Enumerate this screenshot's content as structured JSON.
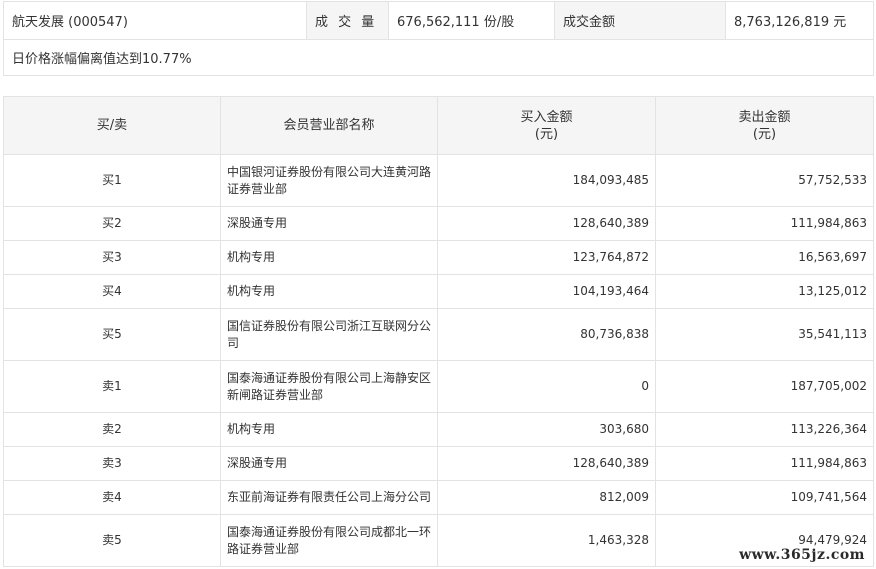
{
  "summary": {
    "stock": "航天发展 (000547)",
    "volume_label": "成 交 量",
    "volume_value": "676,562,111 份/股",
    "amount_label": "成交金额",
    "amount_value": "8,763,126,819 元",
    "note": "日价格涨幅偏离值达到10.77%"
  },
  "table": {
    "headers": {
      "side": "买/卖",
      "name": "会员营业部名称",
      "buy": "买入金额",
      "buy_unit": "(元)",
      "sell": "卖出金额",
      "sell_unit": "(元)"
    },
    "rows": [
      {
        "side": "买1",
        "name": "中国银河证券股份有限公司大连黄河路证券营业部",
        "buy": "184,093,485",
        "sell": "57,752,533"
      },
      {
        "side": "买2",
        "name": "深股通专用",
        "buy": "128,640,389",
        "sell": "111,984,863"
      },
      {
        "side": "买3",
        "name": "机构专用",
        "buy": "123,764,872",
        "sell": "16,563,697"
      },
      {
        "side": "买4",
        "name": "机构专用",
        "buy": "104,193,464",
        "sell": "13,125,012"
      },
      {
        "side": "买5",
        "name": "国信证券股份有限公司浙江互联网分公司",
        "buy": "80,736,838",
        "sell": "35,541,113"
      },
      {
        "side": "卖1",
        "name": "国泰海通证券股份有限公司上海静安区新闸路证券营业部",
        "buy": "0",
        "sell": "187,705,002"
      },
      {
        "side": "卖2",
        "name": "机构专用",
        "buy": "303,680",
        "sell": "113,226,364"
      },
      {
        "side": "卖3",
        "name": "深股通专用",
        "buy": "128,640,389",
        "sell": "111,984,863"
      },
      {
        "side": "卖4",
        "name": "东亚前海证券有限责任公司上海分公司",
        "buy": "812,009",
        "sell": "109,741,564"
      },
      {
        "side": "卖5",
        "name": "国泰海通证券股份有限公司成都北一环路证券营业部",
        "buy": "1,463,328",
        "sell": "94,479,924"
      }
    ]
  },
  "watermark": "www.365jz.com"
}
